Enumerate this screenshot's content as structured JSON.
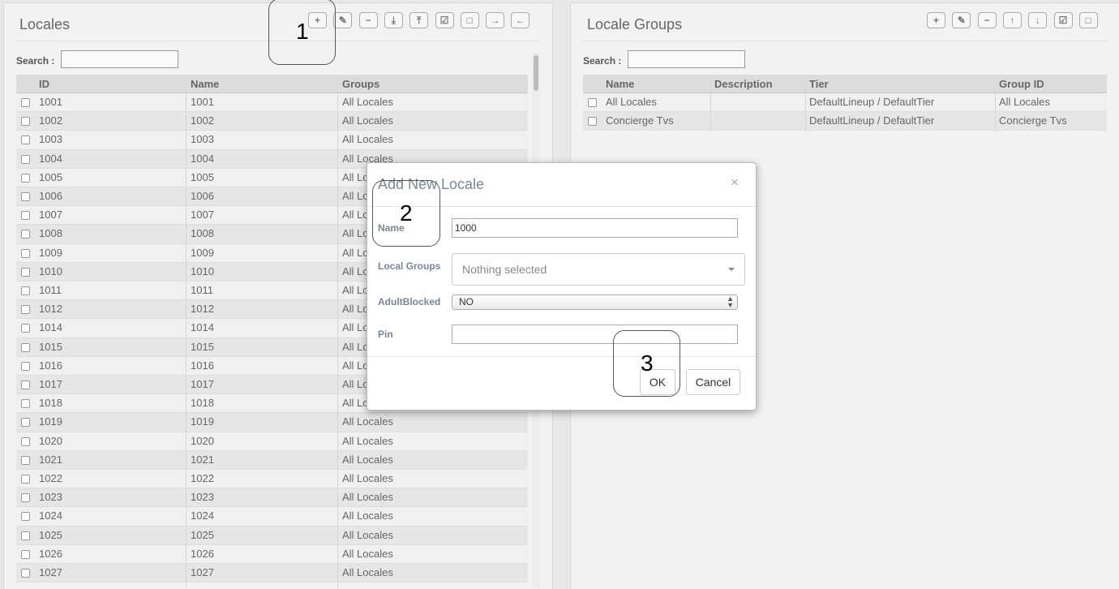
{
  "left_panel": {
    "title": "Locales",
    "search_label": "Search :",
    "columns": [
      "ID",
      "Name",
      "Groups"
    ],
    "toolbar_icons": [
      "add-icon",
      "edit-icon",
      "remove-icon",
      "import-icon",
      "export-icon",
      "check-all-icon",
      "uncheck-all-icon",
      "move-right-icon",
      "move-left-icon"
    ],
    "rows": [
      [
        "1001",
        "1001",
        "All Locales"
      ],
      [
        "1002",
        "1002",
        "All Locales"
      ],
      [
        "1003",
        "1003",
        "All Locales"
      ],
      [
        "1004",
        "1004",
        "All Locales"
      ],
      [
        "1005",
        "1005",
        "All Lo"
      ],
      [
        "1006",
        "1006",
        "All Lo"
      ],
      [
        "1007",
        "1007",
        "All Lo"
      ],
      [
        "1008",
        "1008",
        "All Lo"
      ],
      [
        "1009",
        "1009",
        "All Lo"
      ],
      [
        "1010",
        "1010",
        "All Lo"
      ],
      [
        "1011",
        "1011",
        "All Lo"
      ],
      [
        "1012",
        "1012",
        "All Lo"
      ],
      [
        "1014",
        "1014",
        "All Lo"
      ],
      [
        "1015",
        "1015",
        "All Lo"
      ],
      [
        "1016",
        "1016",
        "All Lo"
      ],
      [
        "1017",
        "1017",
        "All Lo"
      ],
      [
        "1018",
        "1018",
        "All Lo"
      ],
      [
        "1019",
        "1019",
        "All Locales"
      ],
      [
        "1020",
        "1020",
        "All Locales"
      ],
      [
        "1021",
        "1021",
        "All Locales"
      ],
      [
        "1022",
        "1022",
        "All Locales"
      ],
      [
        "1023",
        "1023",
        "All Locales"
      ],
      [
        "1024",
        "1024",
        "All Locales"
      ],
      [
        "1025",
        "1025",
        "All Locales"
      ],
      [
        "1026",
        "1026",
        "All Locales"
      ],
      [
        "1027",
        "1027",
        "All Locales"
      ]
    ]
  },
  "right_panel": {
    "title": "Locale Groups",
    "search_label": "Search :",
    "columns": [
      "Name",
      "Description",
      "Tier",
      "Group ID"
    ],
    "toolbar_icons": [
      "add-icon",
      "edit-icon",
      "remove-icon",
      "move-up-icon",
      "move-down-icon",
      "check-all-icon",
      "uncheck-all-icon"
    ],
    "rows": [
      [
        "All Locales",
        "",
        "DefaultLineup / DefaultTier",
        "All Locales"
      ],
      [
        "Concierge Tvs",
        "",
        "DefaultLineup / DefaultTier",
        "Concierge Tvs"
      ]
    ]
  },
  "modal": {
    "title": "Add New Locale",
    "close": "×",
    "name_label": "Name",
    "name_value": "1000",
    "groups_label": "Local Groups",
    "groups_placeholder": "Nothing selected",
    "adult_label": "AdultBlocked",
    "adult_value": "NO",
    "pin_label": "Pin",
    "pin_value": "",
    "ok_label": "OK",
    "cancel_label": "Cancel"
  },
  "callouts": [
    "1",
    "2",
    "3"
  ]
}
